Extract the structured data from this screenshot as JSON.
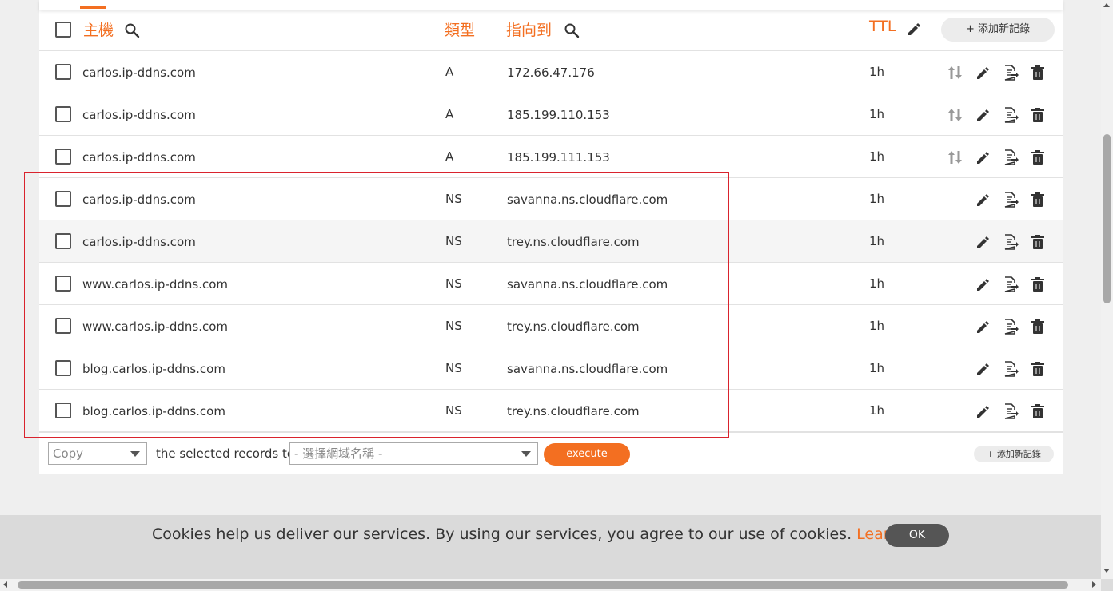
{
  "header": {
    "host": "主機",
    "type": "類型",
    "points_to": "指向到",
    "ttl": "TTL",
    "add_record": "+ 添加新記錄"
  },
  "records": [
    {
      "host": "carlos.ip-ddns.com",
      "type": "A",
      "value": "172.66.47.176",
      "ttl": "1h"
    },
    {
      "host": "carlos.ip-ddns.com",
      "type": "A",
      "value": "185.199.110.153",
      "ttl": "1h"
    },
    {
      "host": "carlos.ip-ddns.com",
      "type": "A",
      "value": "185.199.111.153",
      "ttl": "1h"
    },
    {
      "host": "carlos.ip-ddns.com",
      "type": "NS",
      "value": "savanna.ns.cloudflare.com",
      "ttl": "1h"
    },
    {
      "host": "carlos.ip-ddns.com",
      "type": "NS",
      "value": "trey.ns.cloudflare.com",
      "ttl": "1h"
    },
    {
      "host": "www.carlos.ip-ddns.com",
      "type": "NS",
      "value": "savanna.ns.cloudflare.com",
      "ttl": "1h"
    },
    {
      "host": "www.carlos.ip-ddns.com",
      "type": "NS",
      "value": "trey.ns.cloudflare.com",
      "ttl": "1h"
    },
    {
      "host": "blog.carlos.ip-ddns.com",
      "type": "NS",
      "value": "savanna.ns.cloudflare.com",
      "ttl": "1h"
    },
    {
      "host": "blog.carlos.ip-ddns.com",
      "type": "NS",
      "value": "trey.ns.cloudflare.com",
      "ttl": "1h"
    }
  ],
  "footer": {
    "action_select": "Copy",
    "middle_text": "the selected records to",
    "domain_select": "- 選擇網域名稱 -",
    "execute": "execute",
    "add_record": "+ 添加新記錄"
  },
  "cookie": {
    "text": "Cookies help us deliver our services. By using our services, you agree to our use of cookies.",
    "link": "Learn more",
    "ok": "OK"
  },
  "colors": {
    "accent": "#f36f21",
    "highlight_border": "#d9232d"
  }
}
